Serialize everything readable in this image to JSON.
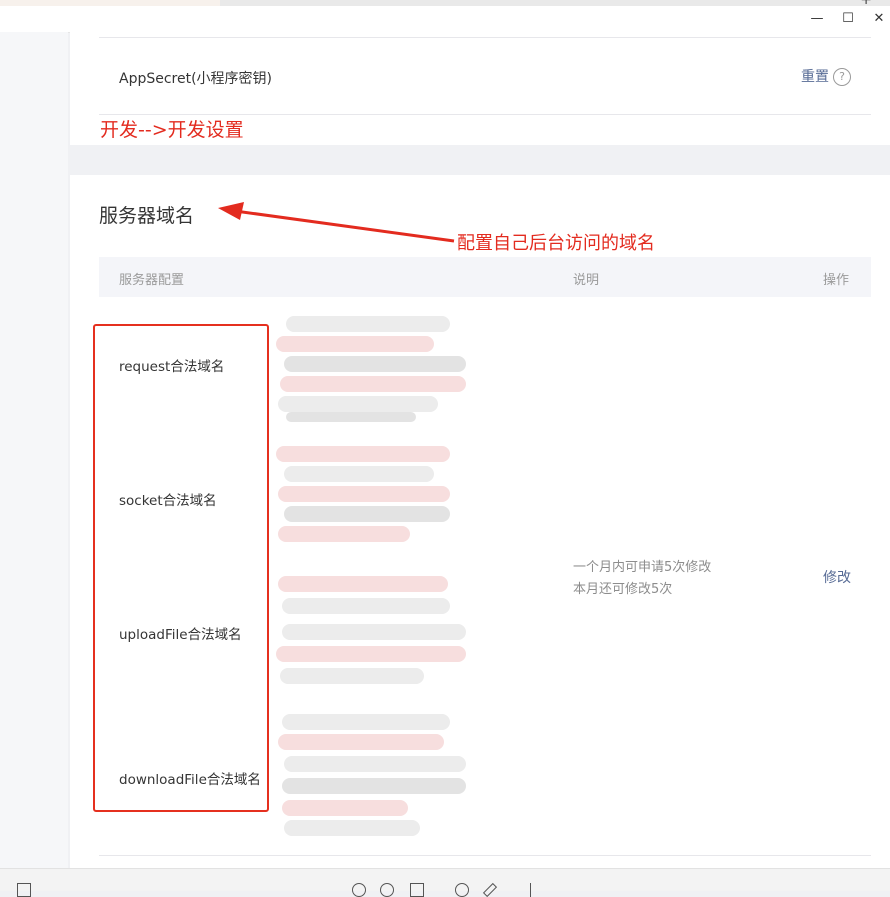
{
  "window": {
    "minimize_glyph": "—",
    "maximize_glyph": "☐",
    "close_glyph": "✕",
    "new_tab_glyph": "+"
  },
  "top_card": {
    "appsecret_label": "AppSecret(小程序密钥)",
    "reset_label": "重置",
    "help_glyph": "?"
  },
  "annotations": {
    "path_note": "开发-->开发设置",
    "server_domain_note": "配置自己后台访问的域名",
    "accent_color": "#e32b1f"
  },
  "server_domain": {
    "title": "服务器域名",
    "columns": {
      "config": "服务器配置",
      "description": "说明",
      "action": "操作"
    },
    "rows": [
      {
        "label": "request合法域名"
      },
      {
        "label": "socket合法域名"
      },
      {
        "label": "uploadFile合法域名"
      },
      {
        "label": "downloadFile合法域名"
      }
    ],
    "description_lines": [
      "一个月内可申请5次修改",
      "本月还可修改5次"
    ],
    "modify_label": "修改",
    "link_color": "#576b95"
  }
}
